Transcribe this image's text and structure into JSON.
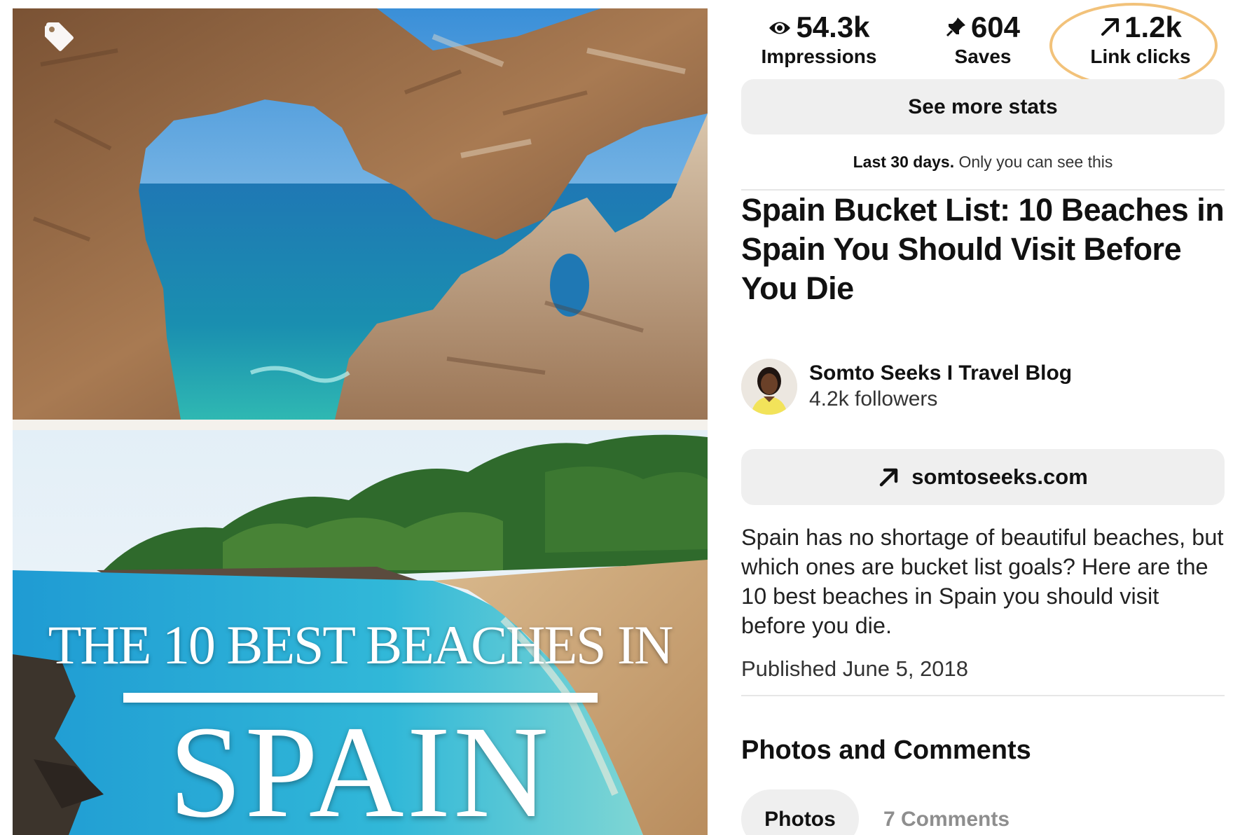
{
  "stats": {
    "impressions": {
      "value": "54.3k",
      "label": "Impressions",
      "icon": "eye-icon"
    },
    "saves": {
      "value": "604",
      "label": "Saves",
      "icon": "pushpin-icon"
    },
    "link_clicks": {
      "value": "1.2k",
      "label": "Link clicks",
      "icon": "arrow-up-right-icon",
      "highlighted": true
    }
  },
  "see_more_stats_label": "See more stats",
  "privacy": {
    "period": "Last 30 days.",
    "note": "Only you can see this"
  },
  "pin": {
    "title": "Spain Bucket List: 10 Beaches in Spain You Should Visit Before You Die",
    "image_overlay": {
      "headline": "THE 10 BEST BEACHES IN",
      "title": "SPAIN"
    },
    "tag_icon": "tag-icon"
  },
  "creator": {
    "name": "Somto Seeks I Travel Blog",
    "followers": "4.2k followers"
  },
  "link": {
    "label": "somtoseeks.com",
    "icon": "arrow-up-right-icon"
  },
  "description": "Spain has no shortage of beautiful beaches, but which ones are bucket list goals? Here are the 10 best beaches in Spain you should visit before you die.",
  "published": "Published June 5, 2018",
  "photos_and_comments": {
    "heading": "Photos and Comments",
    "tabs": [
      {
        "label": "Photos",
        "selected": true
      },
      {
        "label": "7 Comments",
        "selected": false
      }
    ]
  },
  "colors": {
    "highlight_ring": "#f2c27a",
    "button_bg": "#efefef",
    "muted_text": "#8e8e8e"
  }
}
